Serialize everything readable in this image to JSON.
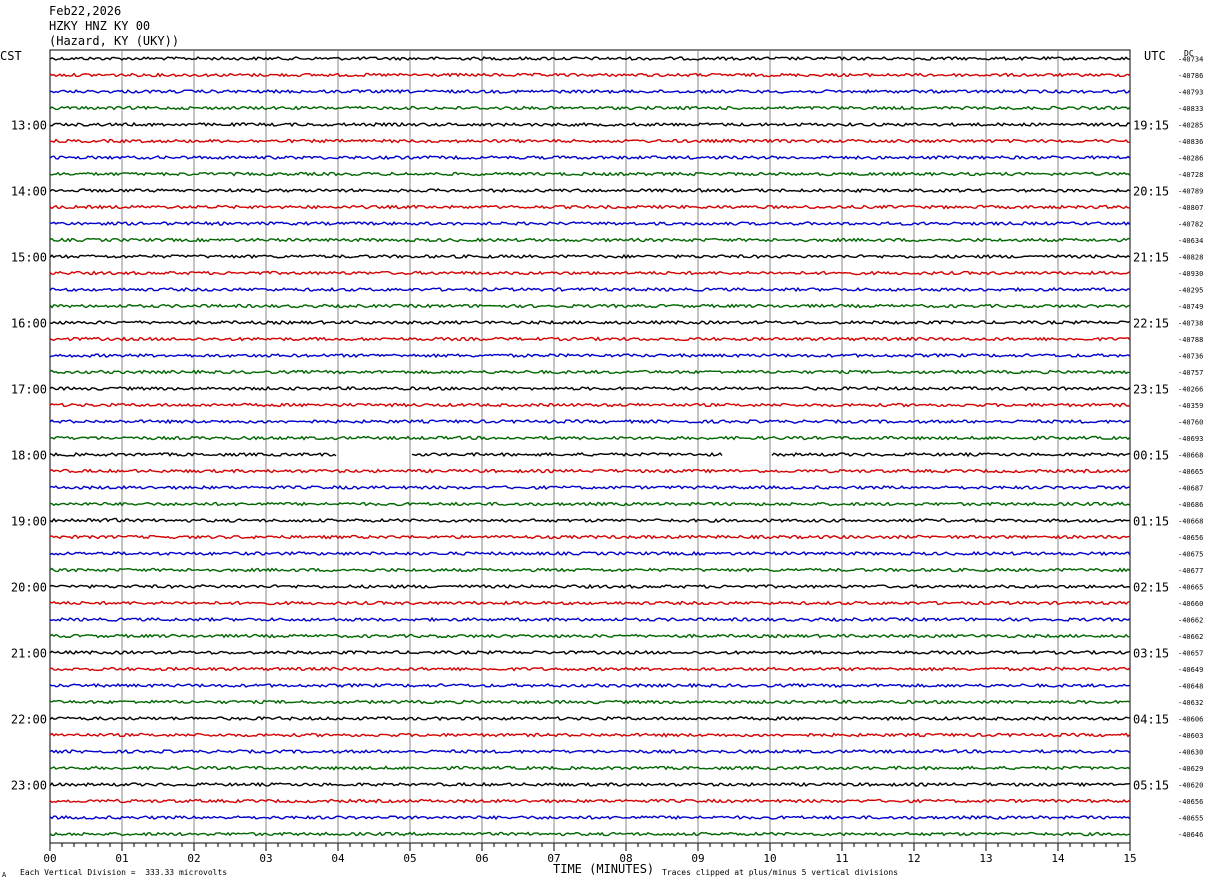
{
  "header": {
    "date": "Feb22,2026",
    "station": "HZKY HNZ KY 00",
    "location": "(Hazard, KY (UKY))"
  },
  "left_tz": "CST",
  "right_tz": "UTC",
  "dc_label": "DC",
  "footer": {
    "scale": "Each Vertical Division =  333.33 microvolts",
    "clip_note": "Traces clipped at plus/minus 5 vertical divisions",
    "corner_mark": "A"
  },
  "colors": {
    "trace_cycle": [
      "#000000",
      "#d40000",
      "#0000cc",
      "#006600"
    ],
    "grid": "#888888"
  },
  "chart_data": {
    "type": "line",
    "title": "HZKY HNZ KY 00",
    "xlabel": "TIME (MINUTES)",
    "xlim": [
      0,
      15
    ],
    "x_ticks": [
      "00",
      "01",
      "02",
      "03",
      "04",
      "05",
      "06",
      "07",
      "08",
      "09",
      "10",
      "11",
      "12",
      "13",
      "14",
      "15"
    ],
    "left_hour_labels": [
      "13:00",
      "14:00",
      "15:00",
      "16:00",
      "17:00",
      "18:00",
      "19:00",
      "20:00",
      "21:00",
      "22:00",
      "23:00"
    ],
    "right_hour_labels": [
      "19:15",
      "20:15",
      "21:15",
      "22:15",
      "23:15",
      "00:15",
      "01:15",
      "02:15",
      "03:15",
      "04:15",
      "05:15"
    ],
    "first_label_row": 4,
    "rows_per_hour": 4,
    "trace_count": 48,
    "dc_offsets": [
      "-40734",
      "-40786",
      "-40793",
      "-40833",
      "-40285",
      "-40836",
      "-40286",
      "-40728",
      "-40789",
      "-40807",
      "-40782",
      "-40634",
      "-40828",
      "-40930",
      "-40295",
      "-40749",
      "-40738",
      "-40788",
      "-40736",
      "-40757",
      "-40266",
      "-40359",
      "-40760",
      "-40693",
      "-40668",
      "-40665",
      "-40687",
      "-40686",
      "-40668",
      "-40656",
      "-40675",
      "-40677",
      "-40665",
      "-40660",
      "-40662",
      "-40662",
      "-40657",
      "-40649",
      "-40648",
      "-40632",
      "-40606",
      "-40603",
      "-40630",
      "-40629",
      "-40620",
      "-40656",
      "-40655",
      "-40646"
    ],
    "gaps": [
      {
        "row": 24,
        "x_start": 4.0,
        "x_end": 5.0
      },
      {
        "row": 24,
        "x_start": 9.35,
        "x_end": 10.0
      }
    ]
  }
}
